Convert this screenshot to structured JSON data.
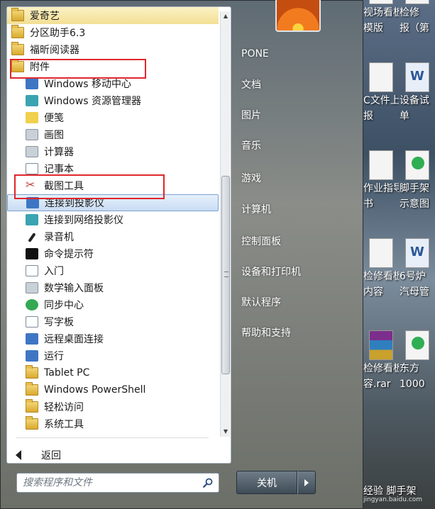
{
  "start_menu": {
    "programs": [
      {
        "label": "爱奇艺",
        "type": "folder",
        "level": 0
      },
      {
        "label": "分区助手6.3",
        "type": "folder",
        "level": 0
      },
      {
        "label": "福昕阅读器",
        "type": "folder",
        "level": 0
      },
      {
        "label": "附件",
        "type": "folder",
        "level": 0
      },
      {
        "label": "Windows 移动中心",
        "type": "app",
        "level": 1
      },
      {
        "label": "Windows 资源管理器",
        "type": "app",
        "level": 1
      },
      {
        "label": "便笺",
        "type": "app",
        "level": 1
      },
      {
        "label": "画图",
        "type": "app",
        "level": 1
      },
      {
        "label": "计算器",
        "type": "app",
        "level": 1
      },
      {
        "label": "记事本",
        "type": "app",
        "level": 1
      },
      {
        "label": "截图工具",
        "type": "app",
        "level": 1
      },
      {
        "label": "连接到投影仪",
        "type": "app",
        "level": 1
      },
      {
        "label": "连接到网络投影仪",
        "type": "app",
        "level": 1
      },
      {
        "label": "录音机",
        "type": "app",
        "level": 1
      },
      {
        "label": "命令提示符",
        "type": "app",
        "level": 1
      },
      {
        "label": "入门",
        "type": "app",
        "level": 1
      },
      {
        "label": "数学输入面板",
        "type": "app",
        "level": 1
      },
      {
        "label": "同步中心",
        "type": "app",
        "level": 1
      },
      {
        "label": "写字板",
        "type": "app",
        "level": 1
      },
      {
        "label": "远程桌面连接",
        "type": "app",
        "level": 1
      },
      {
        "label": "运行",
        "type": "app",
        "level": 1
      },
      {
        "label": "Tablet PC",
        "type": "folder",
        "level": 1
      },
      {
        "label": "Windows PowerShell",
        "type": "folder",
        "level": 1
      },
      {
        "label": "轻松访问",
        "type": "folder",
        "level": 1
      },
      {
        "label": "系统工具",
        "type": "folder",
        "level": 1
      }
    ],
    "back_label": "返回",
    "search": {
      "placeholder": "搜索程序和文件"
    },
    "right_items": [
      "PONE",
      "文档",
      "图片",
      "音乐",
      "游戏",
      "计算机",
      "控制面板",
      "设备和打印机",
      "默认程序",
      "帮助和支持"
    ],
    "shutdown_label": "关机"
  },
  "desktop": {
    "icons": [
      {
        "left_label": [
          "视场看板",
          "模版"
        ],
        "right_label": [
          "检修",
          "报（第"
        ],
        "left_icon": "document-icon",
        "right_icon": "document-icon"
      },
      {
        "left_label": [
          "C文件上",
          "报"
        ],
        "right_label": [
          "设备试",
          "单"
        ],
        "left_icon": "document-icon",
        "right_icon": "word-icon"
      },
      {
        "left_label": [
          "作业指导",
          "书"
        ],
        "right_label": [
          "脚手架",
          "示意图"
        ],
        "left_icon": "document-icon",
        "right_icon": "app-icon"
      },
      {
        "left_label": [
          "检修看板",
          "内容"
        ],
        "right_label": [
          "6号炉",
          "汽母管"
        ],
        "left_icon": "document-icon",
        "right_icon": "word-icon"
      },
      {
        "left_label": [
          "检修看板",
          "容.rar"
        ],
        "right_label": [
          "东方",
          "1000"
        ],
        "left_icon": "rar-icon",
        "right_icon": "app-icon"
      }
    ],
    "watermark_line1": "经验 脚手架",
    "watermark_line2": "jingyan.baidu.com"
  },
  "colors": {
    "highlight_box": "#e0262c",
    "selected_item": "#c9dcf4",
    "folder": "#e7bf4f"
  }
}
